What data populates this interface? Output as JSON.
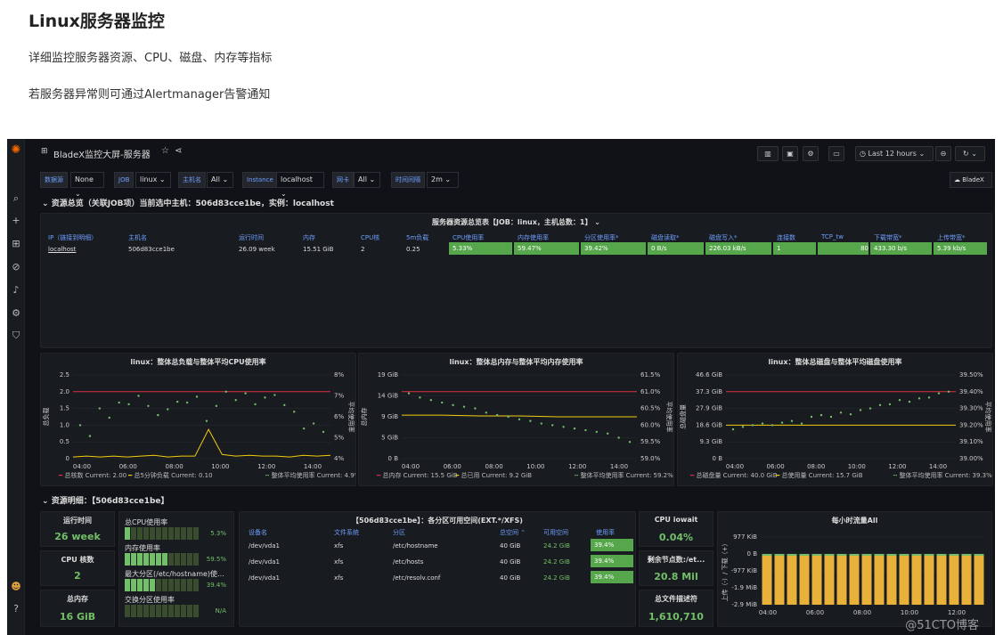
{
  "intro": {
    "title": "Linux服务器监控",
    "p1": "详细监控服务器资源、CPU、磁盘、内存等指标",
    "p2": "若服务器异常则可通过Alertmanager告警通知"
  },
  "dashboard": {
    "title": "BladeX监控大屏-服务器",
    "time_range": "Last 12 hours",
    "user_btn": "BladeX"
  },
  "vars": [
    {
      "label": "数据源",
      "value": "None"
    },
    {
      "label": "JOB",
      "value": "linux"
    },
    {
      "label": "主机名",
      "value": "All"
    },
    {
      "label": "Instance",
      "value": "localhost"
    },
    {
      "label": "网卡",
      "value": "All"
    },
    {
      "label": "时间间隔",
      "value": "2m"
    }
  ],
  "row1": "资源总览（关联JOB项）当前选中主机：506d83cce1be，实例：localhost",
  "overview": {
    "title": "服务器资源总览表【JOB：linux，主机总数：1】",
    "headers": [
      "IP（链接到明细）",
      "主机名",
      "运行时间",
      "内存",
      "CPU核",
      "5m负载",
      "CPU使用率",
      "内存使用率",
      "分区使用率*",
      "磁盘读取*",
      "磁盘写入*",
      "连接数",
      "TCP_tw",
      "下载带宽*",
      "上传带宽*"
    ],
    "row": [
      "localhost",
      "506d83cce1be",
      "26.09 week",
      "15.51 GiB",
      "2",
      "0.25",
      "5.33%",
      "59.47%",
      "39.42%",
      "0 B/s",
      "226.03 kB/s",
      "1",
      "80",
      "433.30 b/s",
      "5.39 kb/s"
    ]
  },
  "chart_cpu": {
    "title": "linux：整体总负载与整体平均CPU使用率",
    "left_ticks": [
      "2.5",
      "2.0",
      "1.5",
      "1.0",
      "0.5",
      "0"
    ],
    "right_ticks": [
      "8%",
      "7%",
      "6%",
      "5%",
      "4%"
    ],
    "x_ticks": [
      "04:00",
      "06:00",
      "08:00",
      "10:00",
      "12:00",
      "14:00"
    ],
    "yl": "总负载",
    "yr": "平均使用率",
    "lg1": "总核数  Current: 2.00",
    "lg2": "总5分钟负载  Current: 0.10",
    "lg3": "整体平均使用率  Current: 4.9%"
  },
  "chart_mem": {
    "title": "linux：整体总内存与整体平均内存使用率",
    "left_ticks": [
      "19 GiB",
      "14 GiB",
      "9 GiB",
      "5 GiB",
      "0 B"
    ],
    "right_ticks": [
      "61.5%",
      "61.0%",
      "60.5%",
      "60.0%",
      "59.5%",
      "59.0%"
    ],
    "x_ticks": [
      "04:00",
      "06:00",
      "08:00",
      "10:00",
      "12:00",
      "14:00"
    ],
    "yl": "总内存",
    "yr": "平均使用率",
    "lg1": "总内存  Current: 15.5 GiB",
    "lg2": "总已用  Current: 9.2 GiB",
    "lg3": "整体平均使用率  Current: 59.2%"
  },
  "chart_disk": {
    "title": "linux：整体总磁盘与整体平均磁盘使用率",
    "left_ticks": [
      "46.6 GiB",
      "37.3 GiB",
      "27.9 GiB",
      "18.6 GiB",
      "9.3 GiB",
      "0 B"
    ],
    "right_ticks": [
      "39.50%",
      "39.40%",
      "39.30%",
      "39.20%",
      "39.10%",
      "39.00%"
    ],
    "x_ticks": [
      "04:00",
      "06:00",
      "08:00",
      "10:00",
      "12:00",
      "14:00"
    ],
    "yl": "总磁盘量",
    "yr": "平均使用率",
    "lg1": "总磁盘量  Current: 40.0 GiB",
    "lg2": "总使用量  Current: 15.7 GiB",
    "lg3": "整体平均使用率  Current: 39.3%"
  },
  "row2": "资源明细：【506d83cce1be】",
  "stats": {
    "uptime_t": "运行时间",
    "uptime_v": "26 week",
    "cores_t": "CPU 核数",
    "cores_v": "2",
    "mem_t": "总内存",
    "mem_v": "16 GiB"
  },
  "gauges": [
    {
      "label": "总CPU使用率",
      "value": "5.3%",
      "level": 0.053
    },
    {
      "label": "内存使用率",
      "value": "59.5%",
      "level": 0.595
    },
    {
      "label": "最大分区(/etc/hostname)使...",
      "value": "39.4%",
      "level": 0.394
    },
    {
      "label": "交换分区使用率",
      "value": "N/A",
      "level": 0
    }
  ],
  "partition": {
    "title": "【506d83cce1be】：各分区可用空间(EXT.*/XFS)",
    "headers": [
      "设备名",
      "文件系统",
      "分区",
      "总空间 ⌃",
      "可用空间",
      "使用率"
    ],
    "rows": [
      [
        "/dev/vda1",
        "xfs",
        "/etc/hostname",
        "40 GiB",
        "24.2 GiB",
        "39.4%"
      ],
      [
        "/dev/vda1",
        "xfs",
        "/etc/hosts",
        "40 GiB",
        "24.2 GiB",
        "39.4%"
      ],
      [
        "/dev/vda1",
        "xfs",
        "/etc/resolv.conf",
        "40 GiB",
        "24.2 GiB",
        "39.4%"
      ]
    ]
  },
  "iowait": {
    "t": "CPU iowait",
    "v": "0.04%"
  },
  "inodes": {
    "t": "剩余节点数:/et...",
    "v": "20.8 Mil"
  },
  "fds": {
    "t": "总文件描述符",
    "v": "1,610,710"
  },
  "traffic": {
    "title": "每小时流量All",
    "left_ticks": [
      "977 KiB",
      "0 B",
      "-977 KiB",
      "-1.9 MiB",
      "-2.9 MiB"
    ],
    "x_ticks": [
      "04:00",
      "06:00",
      "08:00",
      "10:00",
      "12:00"
    ],
    "yl": "上传（-）/ 下载（+）",
    "bars": 18
  },
  "watermark": "@51CTO博客",
  "colors": {
    "green": "#56a64b",
    "red": "#e02f44",
    "yellow": "#f2cc0c",
    "bg": "#111217"
  }
}
